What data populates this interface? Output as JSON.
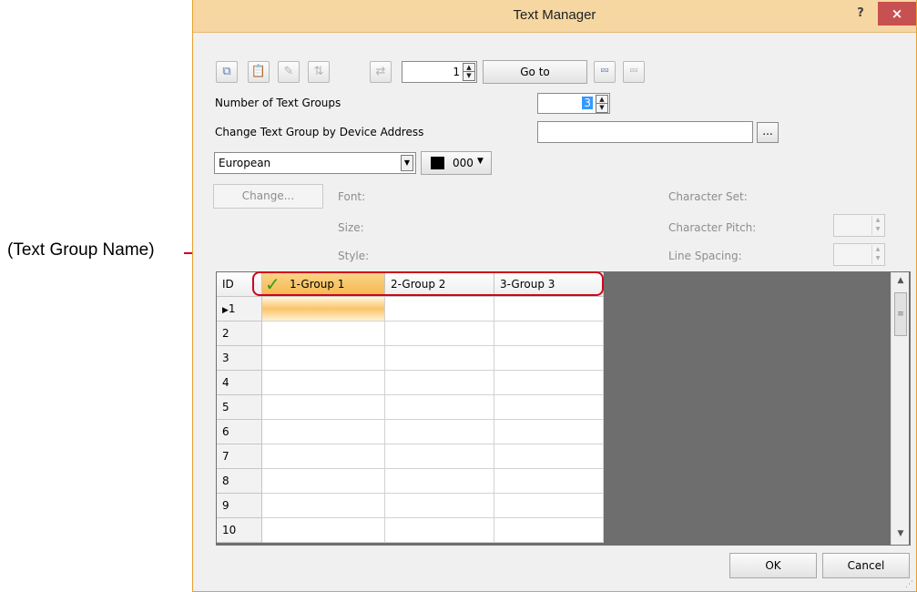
{
  "callout": {
    "label": "(Text Group Name)"
  },
  "window": {
    "title": "Text Manager",
    "help": "?",
    "close": "×"
  },
  "toolbar": {
    "copy_icon": "copy-icon",
    "paste_icon": "paste-icon",
    "clear_icon": "clear-icon",
    "sort_icon": "sort-icon",
    "replace_icon": "replace-icon",
    "row_value": "1",
    "goto_label": "Go to",
    "import_icon": "import-icon",
    "export_icon": "export-icon"
  },
  "number_of_text_groups": {
    "label": "Number of Text Groups",
    "value": "3"
  },
  "device_address": {
    "label": "Change Text Group by Device Address",
    "value": "",
    "browse": "..."
  },
  "language": {
    "selected": "European"
  },
  "color": {
    "value": "000",
    "swatch": "#000000"
  },
  "font_section": {
    "change_button": "Change...",
    "font_label": "Font:",
    "size_label": "Size:",
    "style_label": "Style:",
    "charset_label": "Character Set:",
    "pitch_label": "Character Pitch:",
    "spacing_label": "Line Spacing:"
  },
  "table": {
    "id_header": "ID",
    "columns": [
      "1-Group 1",
      "2-Group 2",
      "3-Group 3"
    ],
    "rows": [
      "1",
      "2",
      "3",
      "4",
      "5",
      "6",
      "7",
      "8",
      "9",
      "10"
    ],
    "selected_column": 0,
    "current_row": 0
  },
  "dialog_buttons": {
    "ok": "OK",
    "cancel": "Cancel"
  }
}
